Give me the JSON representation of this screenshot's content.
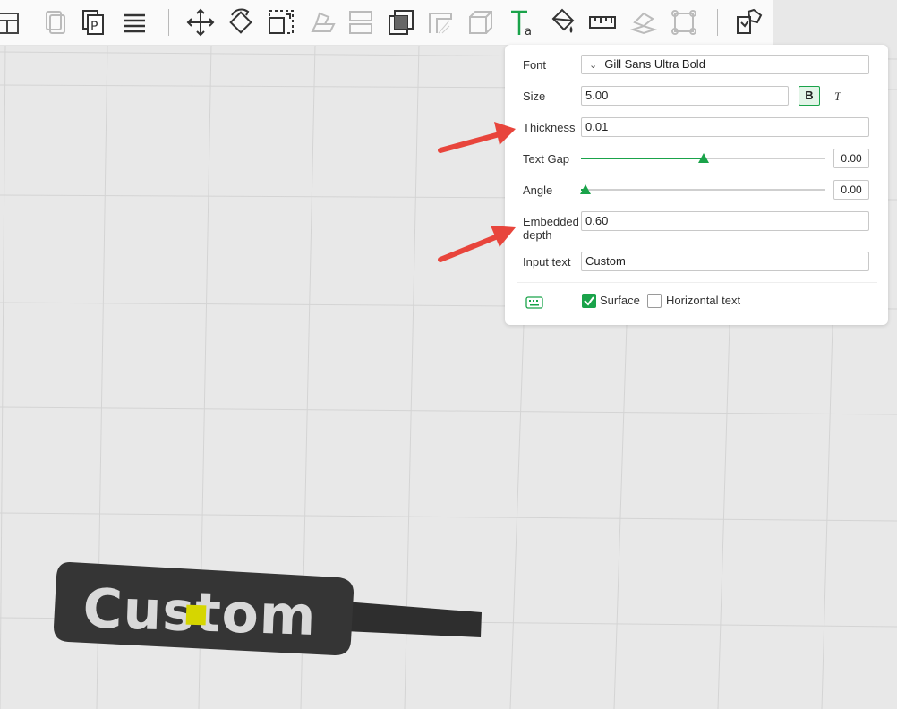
{
  "toolbar": {
    "icons": [
      "layout-icon",
      "copy-icon",
      "place-icon",
      "layers-icon",
      "move-icon",
      "rotate-icon",
      "scale-icon",
      "lay-on-face-icon",
      "split-icon",
      "boolean-icon",
      "support-icon",
      "measure-box-icon",
      "text-tool-icon",
      "paint-bucket-icon",
      "ruler-icon",
      "assembly-icon",
      "fit-view-icon",
      "puzzle-icon"
    ]
  },
  "panel": {
    "font_label": "Font",
    "font_value": "Gill Sans Ultra Bold",
    "size_label": "Size",
    "size_value": "5.00",
    "bold_label": "B",
    "italic_label": "T",
    "thickness_label": "Thickness",
    "thickness_value": "0.01",
    "text_gap_label": "Text Gap",
    "text_gap_value": "0.00",
    "text_gap_slider_fraction": 0.5,
    "angle_label": "Angle",
    "angle_value": "0.00",
    "angle_slider_fraction": 0.02,
    "embedded_label_1": "Embedded",
    "embedded_label_2": "depth",
    "embedded_value": "0.60",
    "input_text_label": "Input text",
    "input_text_value": "Custom",
    "surface_label": "Surface",
    "surface_checked": true,
    "horizontal_label": "Horizontal text",
    "horizontal_checked": false
  },
  "model": {
    "text": "Custom"
  },
  "colors": {
    "accent": "#1aa34a",
    "arrow": "#e8453c",
    "model_body": "#353535",
    "model_text": "#d9d9d9",
    "highlight": "#d6d600"
  }
}
